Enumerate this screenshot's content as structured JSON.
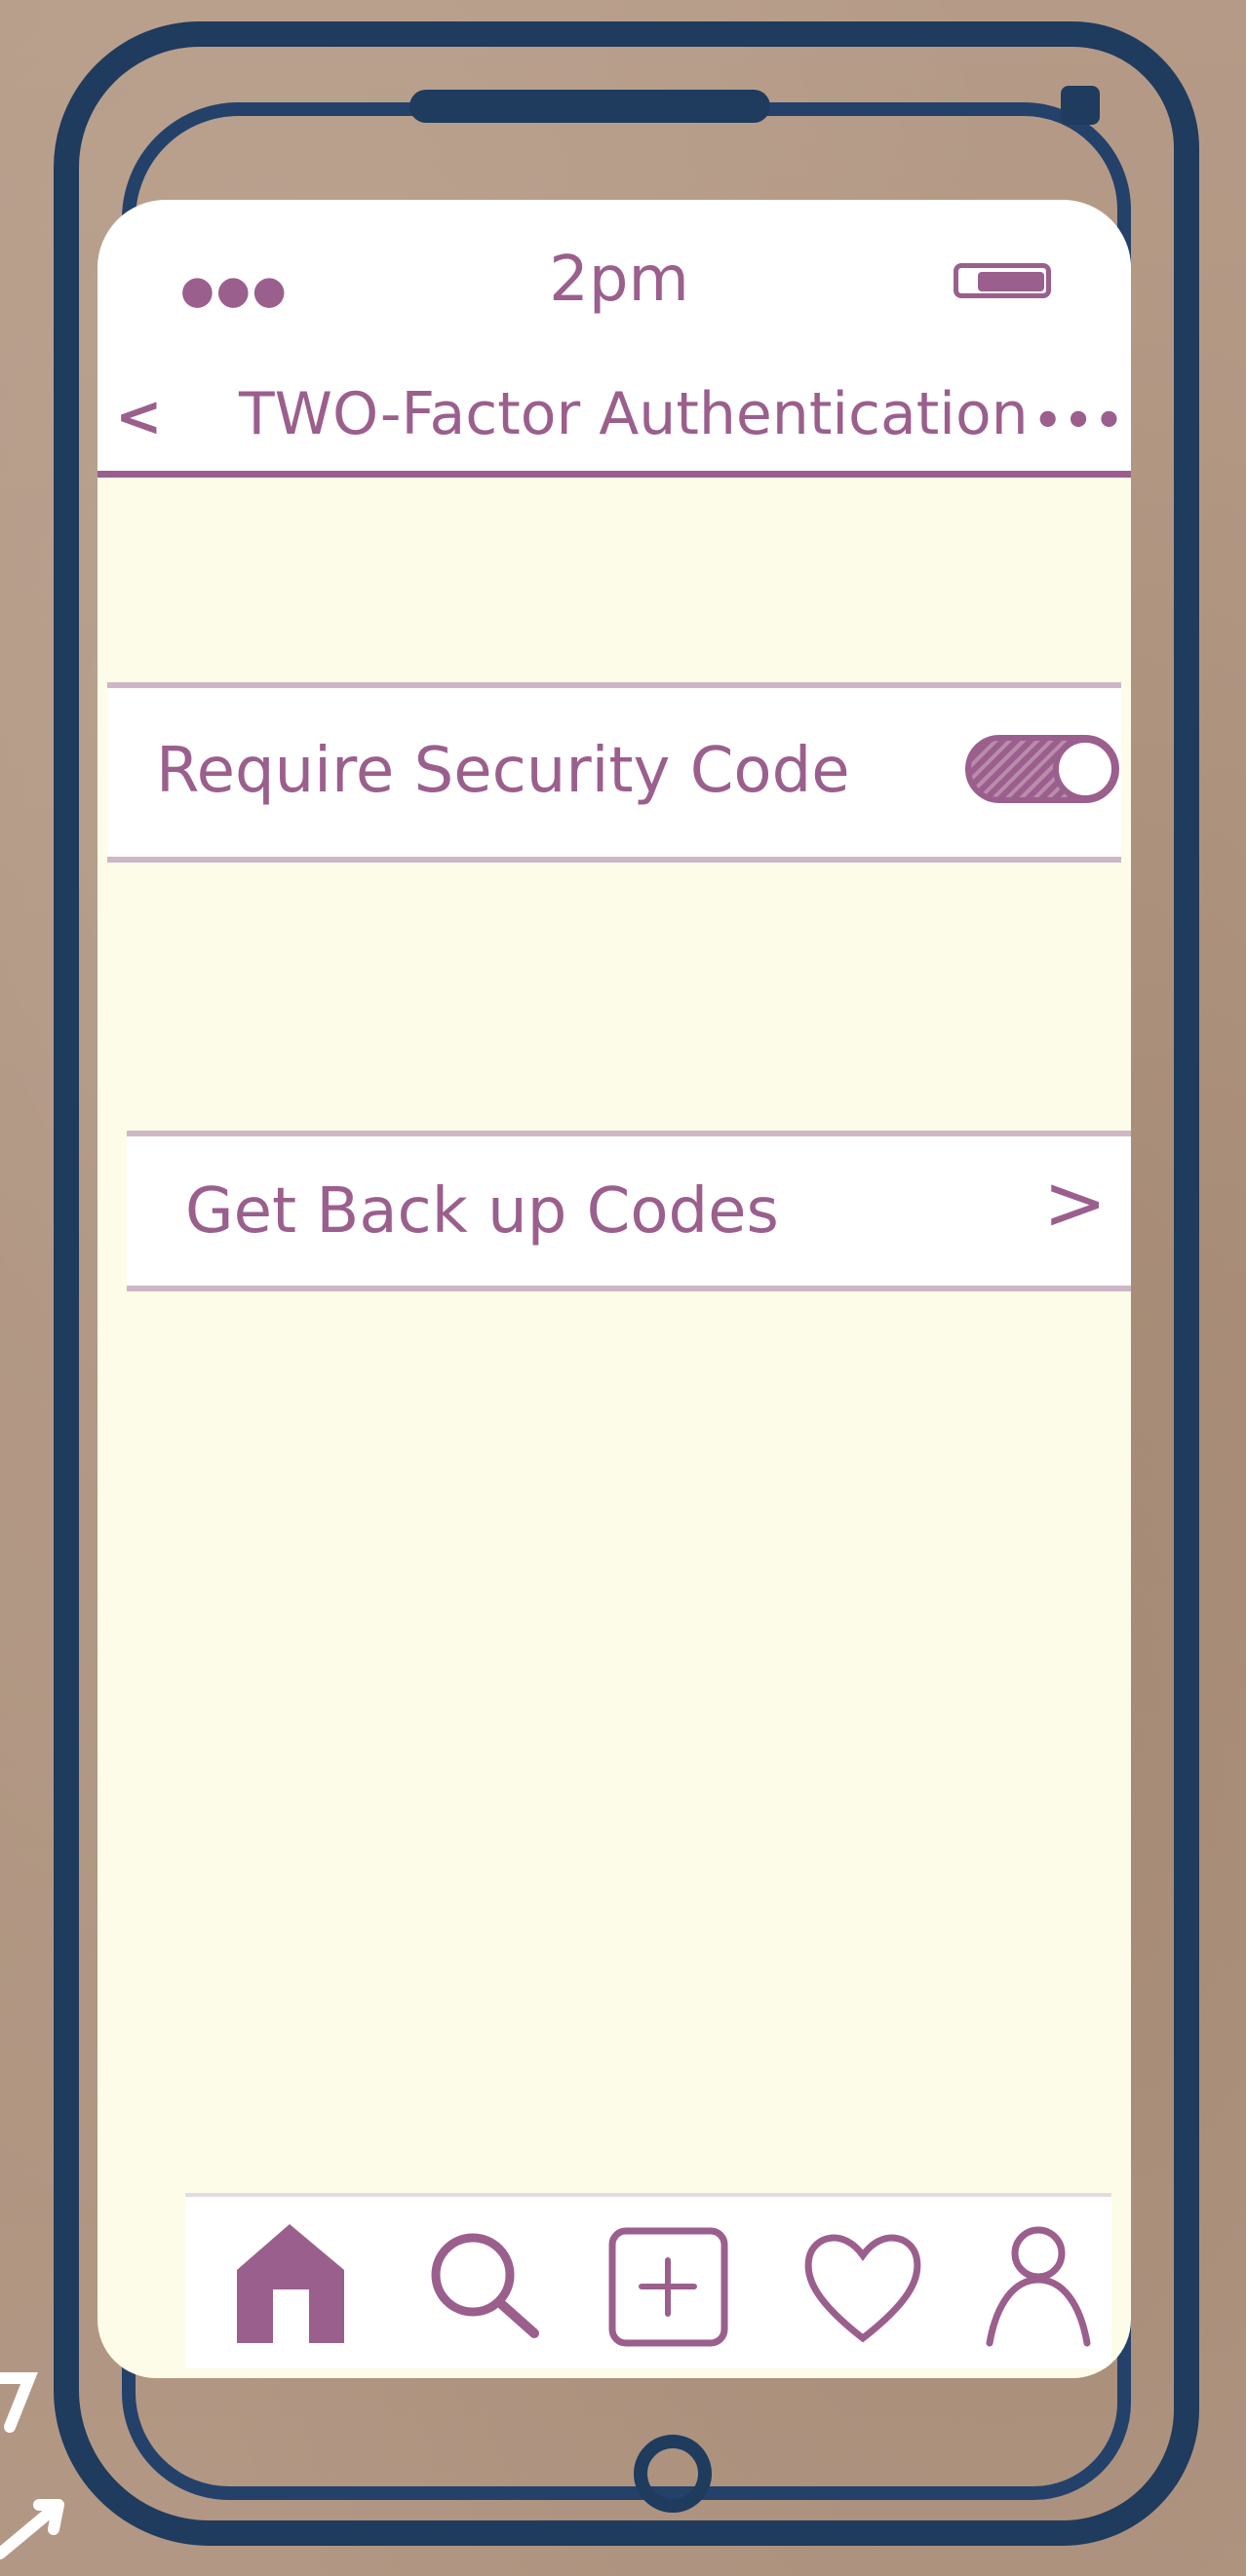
{
  "status_bar": {
    "time": "2pm"
  },
  "nav": {
    "title": "TWO-Factor Authentication"
  },
  "settings": {
    "require_security_code": {
      "label": "Require Security Code",
      "enabled": true
    },
    "backup_codes": {
      "label": "Get Back up Codes"
    }
  },
  "tab_bar": {
    "items": [
      {
        "icon": "home-icon",
        "active": true
      },
      {
        "icon": "search-icon",
        "active": false
      },
      {
        "icon": "add-post-icon",
        "active": false
      },
      {
        "icon": "heart-icon",
        "active": false
      },
      {
        "icon": "profile-icon",
        "active": false
      }
    ]
  },
  "colors": {
    "accent": "#9b5f8d",
    "phone_outline": "#1f3b5e",
    "screen_background": "#fdfce8",
    "row_background": "#ffffff",
    "divider": "#cdb7c6"
  }
}
